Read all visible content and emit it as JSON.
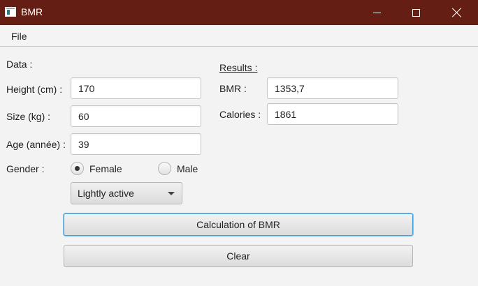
{
  "window": {
    "title": "BMR",
    "controls": [
      "minimize-icon",
      "maximize-icon",
      "close-icon"
    ]
  },
  "menu": {
    "file": "File"
  },
  "data_section": {
    "heading": "Data :",
    "height_label": "Height (cm) :",
    "height_value": "170",
    "size_label": "Size (kg) :",
    "size_value": "60",
    "age_label": "Age (année) :",
    "age_value": "39",
    "gender_label": "Gender :",
    "gender_options": [
      "Female",
      "Male"
    ],
    "gender_selected": "Female",
    "activity_selected": "Lightly active"
  },
  "results": {
    "heading": "Results :",
    "bmr_label": "BMR :",
    "bmr_value": "1353,7",
    "calories_label": "Calories :",
    "calories_value": "1861"
  },
  "buttons": {
    "calculate": "Calculation of BMR",
    "clear": "Clear"
  },
  "colors": {
    "titlebar": "#641e14",
    "focus": "#3d9fdb"
  }
}
